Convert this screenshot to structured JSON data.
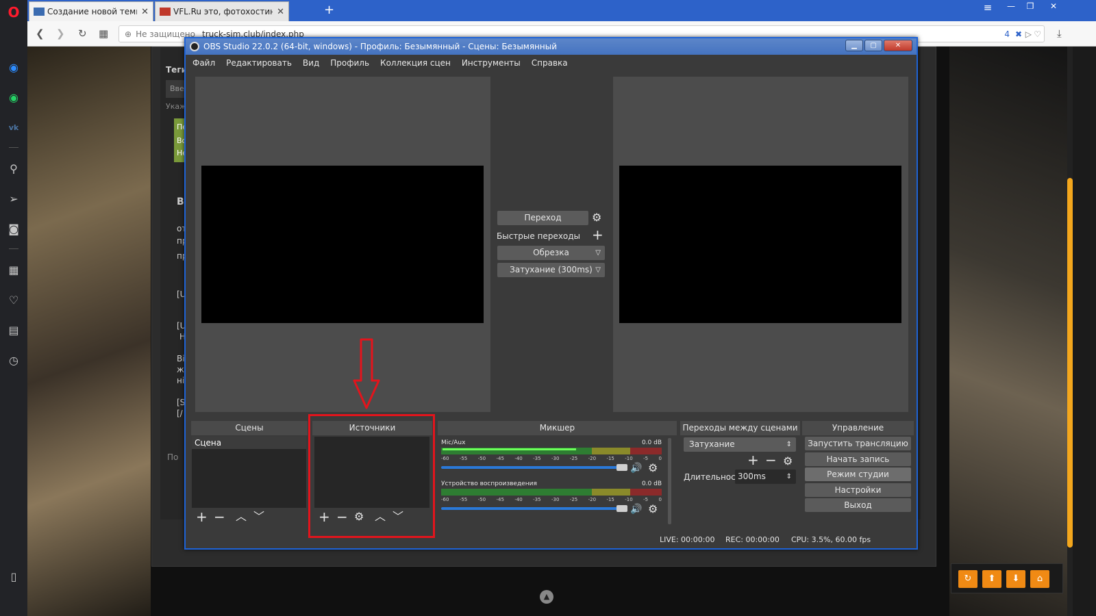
{
  "browser": {
    "tabs": [
      {
        "title": "Создание новой темы - Т",
        "favicon": "truck-favicon"
      },
      {
        "title": "VFL.Ru это, фотохостинг б",
        "favicon": "vfl-favicon"
      }
    ],
    "security_label": "Не защищено",
    "url": "truck-sim.club/index.php",
    "badge_count": "4"
  },
  "website": {
    "tags_label": "Теги",
    "input_placeholder": "Введ",
    "hint": "Укажи",
    "green_lines": [
      "Пер",
      "Воз",
      "Не з"
    ],
    "text_fragments": [
      "В",
      "от",
      "пр",
      "пр",
      "[U",
      "[U",
      "Н",
      "Ві",
      "жі",
      "ні",
      "[S",
      "[/",
      "По"
    ]
  },
  "obs": {
    "title": "OBS Studio 22.0.2 (64-bit, windows) - Профиль: Безымянный - Сцены: Безымянный",
    "menu": [
      "Файл",
      "Редактировать",
      "Вид",
      "Профиль",
      "Коллекция сцен",
      "Инструменты",
      "Справка"
    ],
    "transition": {
      "button": "Переход",
      "quick_label": "Быстрые переходы",
      "dd1": "Обрезка",
      "dd2": "Затухание (300ms)"
    },
    "docks": {
      "scenes": {
        "title": "Сцены",
        "items": [
          "Сцена"
        ]
      },
      "sources": {
        "title": "Источники"
      },
      "mixer": {
        "title": "Микшер",
        "tracks": [
          {
            "name": "Mic/Aux",
            "db": "0.0 dB"
          },
          {
            "name": "Устройство воспроизведения",
            "db": "0.0 dB"
          }
        ],
        "ticks": [
          "-60",
          "-55",
          "-50",
          "-45",
          "-40",
          "-35",
          "-30",
          "-25",
          "-20",
          "-15",
          "-10",
          "-5",
          "0"
        ]
      },
      "transitions": {
        "title": "Переходы между сценами",
        "selected": "Затухание",
        "duration_label": "Длительность",
        "duration_value": "300ms"
      },
      "controls": {
        "title": "Управление",
        "buttons": [
          "Запустить трансляцию",
          "Начать запись",
          "Режим студии",
          "Настройки",
          "Выход"
        ]
      }
    },
    "status": {
      "live": "LIVE: 00:00:00",
      "rec": "REC: 00:00:00",
      "cpu": "CPU: 3.5%, 60.00 fps"
    }
  },
  "annotation": {
    "color": "#e3141c"
  }
}
